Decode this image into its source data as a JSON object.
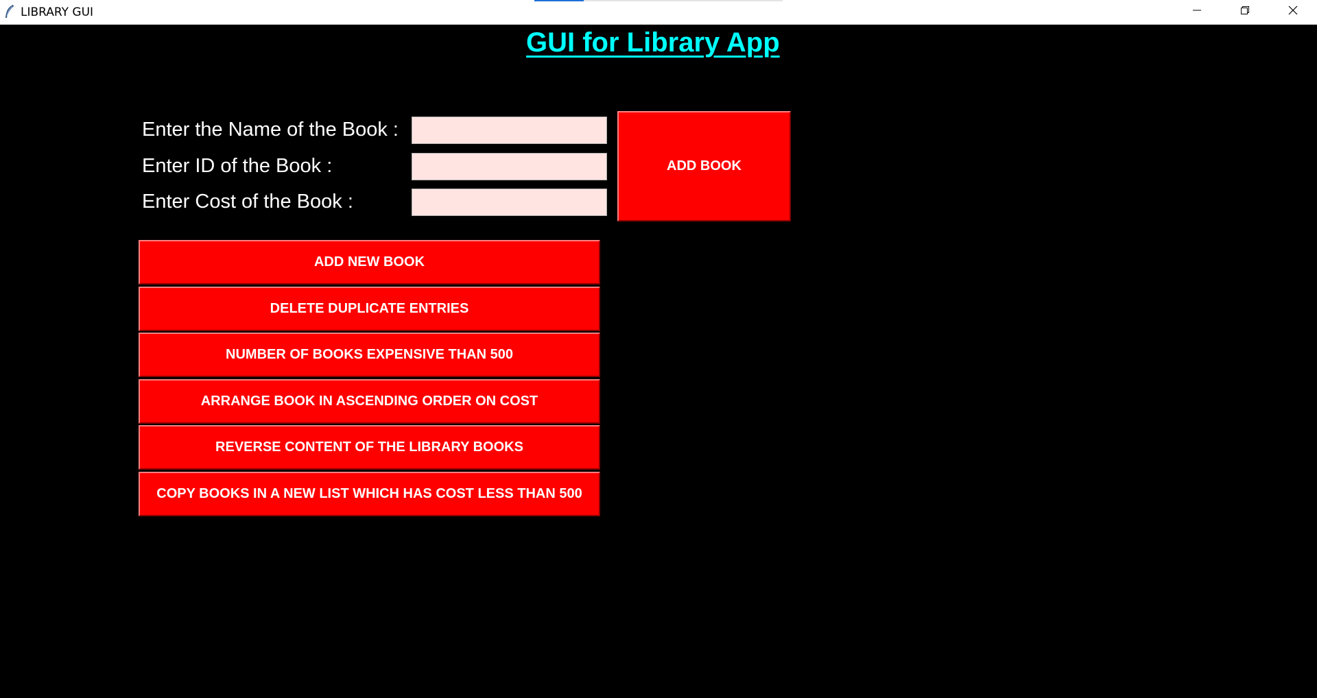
{
  "window": {
    "title": "LIBRARY GUI",
    "app_icon": "feather-icon",
    "controls": {
      "minimize_icon": "minimize-icon",
      "restore_icon": "restore-icon",
      "close_icon": "close-icon"
    }
  },
  "app": {
    "heading": "GUI for Library App",
    "heading_color": "#00ffff",
    "background_color": "#000000",
    "button_color": "#ff0000",
    "entry_color": "#ffe4e1"
  },
  "form": {
    "name_label": "Enter the Name of the Book :",
    "name_value": "",
    "id_label": "Enter ID of the Book :",
    "id_value": "",
    "cost_label": "Enter Cost of the Book :",
    "cost_value": "",
    "add_book_label": "ADD BOOK"
  },
  "actions": [
    {
      "label": "ADD NEW BOOK"
    },
    {
      "label": "DELETE DUPLICATE ENTRIES"
    },
    {
      "label": "NUMBER OF BOOKS EXPENSIVE THAN 500"
    },
    {
      "label": "ARRANGE BOOK IN ASCENDING ORDER ON COST"
    },
    {
      "label": "REVERSE CONTENT OF THE LIBRARY BOOKS"
    },
    {
      "label": "COPY BOOKS IN A NEW LIST WHICH HAS COST LESS THAN 500"
    }
  ]
}
